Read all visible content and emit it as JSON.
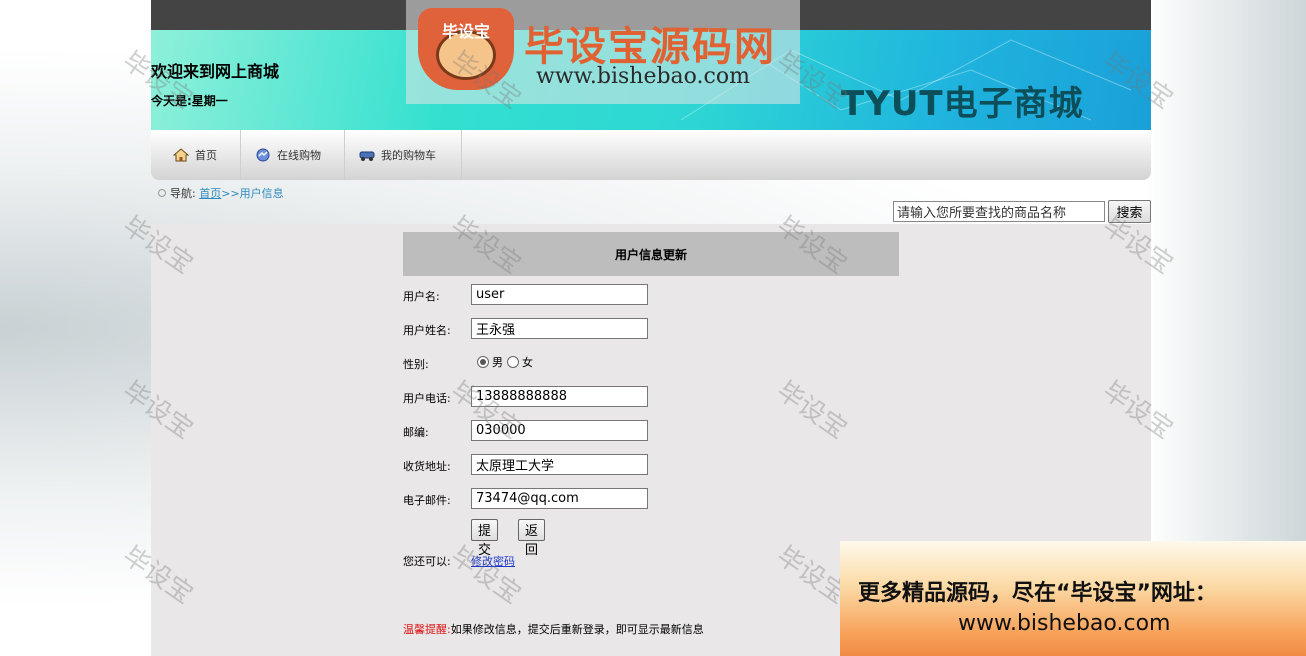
{
  "header": {
    "welcome": "欢迎来到网上商城",
    "today": "今天是:星期一",
    "shop_name": "TYUT电子商城"
  },
  "watermark_logo": {
    "badge_label": "毕设宝",
    "brand": "毕设宝源码网",
    "url": "www.bishebao.com"
  },
  "nav": {
    "items": [
      {
        "label": "首页",
        "icon": "home-icon"
      },
      {
        "label": "在线购物",
        "icon": "shopping-icon"
      },
      {
        "label": "我的购物车",
        "icon": "cart-icon"
      }
    ]
  },
  "breadcrumb": {
    "prefix": "导航:",
    "home": "首页",
    "sep": ">>",
    "current": "用户信息"
  },
  "search": {
    "placeholder": "请输入您所要查找的商品名称",
    "button": "搜索"
  },
  "form": {
    "title": "用户信息更新",
    "username_label": "用户名:",
    "username": "user",
    "realname_label": "用户姓名:",
    "realname": "王永强",
    "gender_label": "性别:",
    "gender_male": "男",
    "gender_female": "女",
    "gender_selected": "男",
    "phone_label": "用户电话:",
    "phone": "13888888888",
    "zip_label": "邮编:",
    "zip": "030000",
    "address_label": "收货地址:",
    "address": "太原理工大学",
    "email_label": "电子邮件:",
    "email": "73474@qq.com",
    "submit": "提交",
    "back": "返回",
    "also_label": "您还可以:",
    "change_password": "修改密码"
  },
  "tip": {
    "warn": "温馨提醒:",
    "text": "如果修改信息，提交后重新登录，即可显示最新信息"
  },
  "watermark_text": "毕设宝",
  "promo": {
    "line1": "更多精品源码，尽在“毕设宝”网址：",
    "line2": "www.bishebao.com"
  }
}
